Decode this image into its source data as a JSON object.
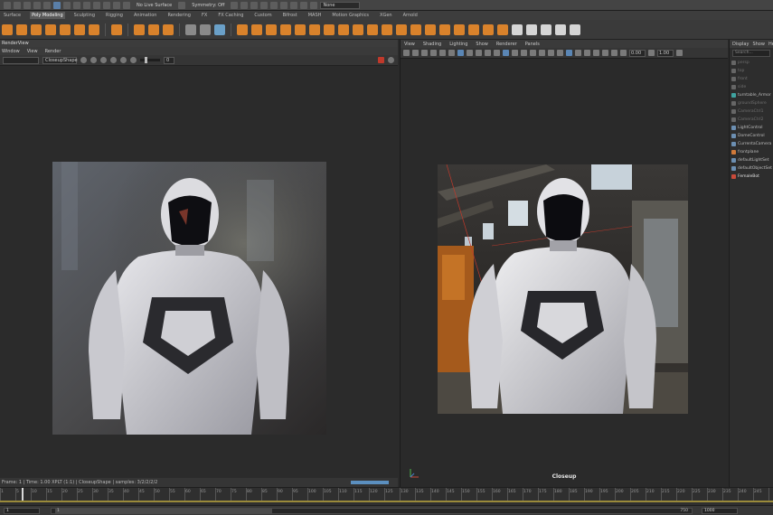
{
  "statusbar": {
    "live_surface": "No Live Surface",
    "symmetry": "Symmetry: Off",
    "workspace": "None"
  },
  "shelf_tabs": [
    "Surface",
    "Poly Modeling",
    "Sculpting",
    "Rigging",
    "Animation",
    "Rendering",
    "FX",
    "FX Caching",
    "Custom",
    "Bifrost",
    "MASH",
    "Motion Graphics",
    "XGen",
    "Arnold"
  ],
  "active_shelf_tab": "Poly Modeling",
  "render_view": {
    "title": "RenderView",
    "menus": [
      "Window",
      "View",
      "Render"
    ],
    "camera": "CloseupShape",
    "exposure": "0",
    "status": "Frame: 1  |  Time: 1.00 XPLT (1:1)  |  CloseupShape  |  samples: 3/2/2/2/2",
    "render_image": "armored-figure-render-dof"
  },
  "viewport": {
    "menus": [
      "View",
      "Shading",
      "Lighting",
      "Show",
      "Renderer",
      "Panels"
    ],
    "field_a": "0.00",
    "field_b": "1.00",
    "camera_label": "Closeup",
    "render_image": "armored-figure-hangar-render"
  },
  "outliner": {
    "menus": [
      "Display",
      "Show",
      "Help"
    ],
    "search_placeholder": "Search...",
    "items": [
      {
        "label": "persp",
        "style": "dim"
      },
      {
        "label": "top",
        "style": "dim"
      },
      {
        "label": "front",
        "style": "dim"
      },
      {
        "label": "side",
        "style": "dim"
      },
      {
        "label": "turntable_Armor",
        "style": "normal"
      },
      {
        "label": "groundSphere",
        "style": "dim"
      },
      {
        "label": "CameraCtrl1",
        "style": "dim"
      },
      {
        "label": "CameraCtrl2",
        "style": "dim"
      },
      {
        "label": "LightControl",
        "style": "normal"
      },
      {
        "label": "DomeControl",
        "style": "normal"
      },
      {
        "label": "CurrentaCamera",
        "style": "normal"
      },
      {
        "label": "frontplane",
        "style": "normal"
      },
      {
        "label": "defaultLightSet",
        "style": "normal"
      },
      {
        "label": "defaultObjectSet",
        "style": "normal"
      },
      {
        "label": "FemaleBot",
        "style": "sel"
      }
    ]
  },
  "timeline": {
    "ticks": [
      "1",
      "5",
      "10",
      "15",
      "20",
      "25",
      "30",
      "35",
      "40",
      "45",
      "50",
      "55",
      "60",
      "65",
      "70",
      "75",
      "80",
      "85",
      "90",
      "95",
      "100",
      "105",
      "110",
      "115",
      "120",
      "125",
      "130",
      "135",
      "140",
      "145",
      "150",
      "155",
      "160",
      "165",
      "170",
      "175",
      "180",
      "185",
      "190",
      "195",
      "200",
      "205",
      "210",
      "215",
      "220",
      "225",
      "230",
      "235",
      "240",
      "245"
    ],
    "current_frame": "1"
  },
  "range": {
    "start": "1",
    "inner_start": "1",
    "inner_end": "750",
    "end": "1000"
  },
  "colors": {
    "accent_orange": "#d9822b",
    "accent_blue": "#5a86b5",
    "panel_bg": "#2b2b2b"
  }
}
